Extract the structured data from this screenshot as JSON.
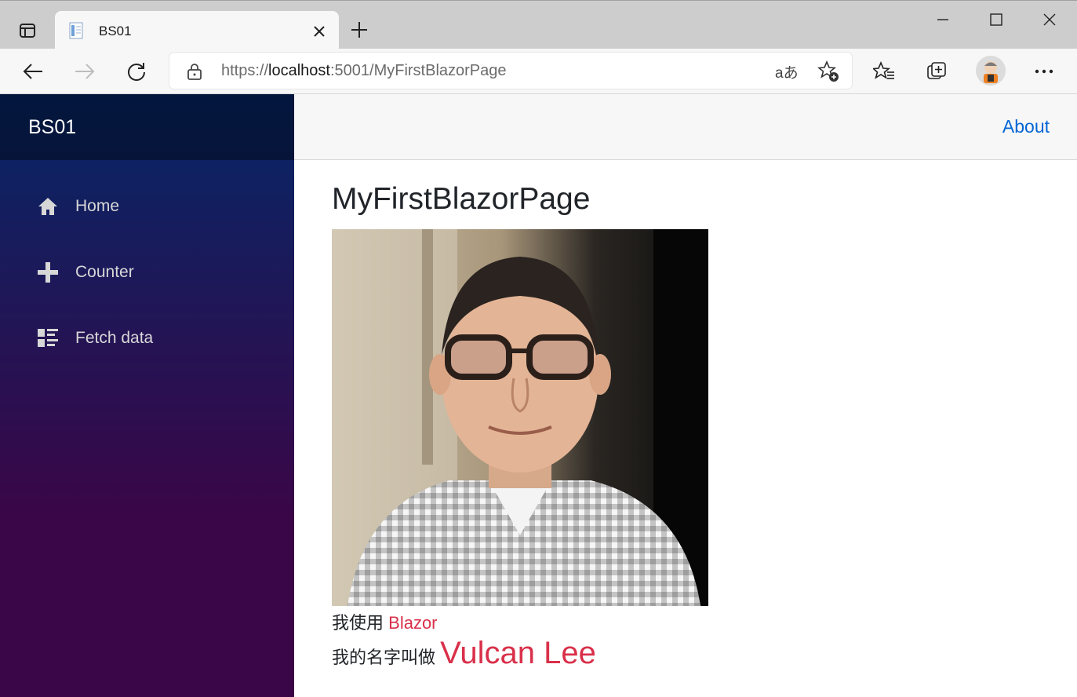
{
  "browser": {
    "tab_title": "BS01",
    "url_scheme": "https://",
    "url_host": "localhost",
    "url_rest": ":5001/MyFirstBlazorPage",
    "read_aloud_label": "aあ"
  },
  "app": {
    "brand": "BS01",
    "nav": [
      {
        "label": "Home",
        "icon": "home-icon"
      },
      {
        "label": "Counter",
        "icon": "plus-icon"
      },
      {
        "label": "Fetch data",
        "icon": "list-rich-icon"
      }
    ],
    "about_label": "About"
  },
  "page": {
    "title": "MyFirstBlazorPage",
    "line1_prefix": "我使用",
    "line1_highlight": "Blazor",
    "line2_prefix": "我的名字叫做",
    "line2_highlight": "Vulcan Lee"
  },
  "colors": {
    "accent_red": "#d9304a",
    "link_blue": "#0366d6",
    "sidebar_top": "#052767",
    "sidebar_bottom": "#3a0647"
  }
}
